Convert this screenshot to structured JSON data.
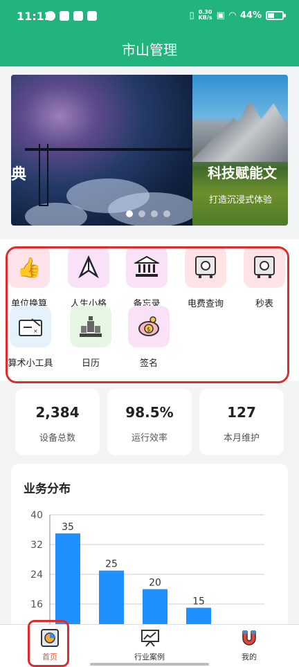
{
  "status_bar": {
    "time": "11:12",
    "speed_value": "0.30",
    "speed_unit": "KB/s",
    "battery": "44%",
    "battery_level": 0.44
  },
  "header": {
    "title": "市山管理"
  },
  "banner": {
    "slides": [
      {
        "caption": "典"
      },
      {
        "caption": "科技赋能文",
        "subcaption": "打造沉浸式体验"
      }
    ],
    "indicator_count": 4,
    "active_indicator": 0
  },
  "grid": {
    "items": [
      {
        "label": "单位换算",
        "icon": "thumbs-up-icon",
        "bg": "#ffe3ea"
      },
      {
        "label": "人生小格",
        "icon": "paper-plane-icon",
        "bg": "#f9e1f7"
      },
      {
        "label": "备忘录",
        "icon": "bank-icon",
        "bg": "#f9e1f7"
      },
      {
        "label": "电费查询",
        "icon": "safe-icon",
        "bg": "#ffe3e6"
      },
      {
        "label": "秒表",
        "icon": "safe-icon",
        "bg": "#ffe3e6"
      },
      {
        "label": "算术小工具",
        "icon": "calculator-board-icon",
        "bg": "#e3f2fc"
      },
      {
        "label": "日历",
        "icon": "chess-icon",
        "bg": "#e5f7e2"
      },
      {
        "label": "签名",
        "icon": "piggy-bank-icon",
        "bg": "#f9e1f7"
      }
    ]
  },
  "stats": [
    {
      "value": "2,384",
      "label": "设备总数"
    },
    {
      "value": "98.5%",
      "label": "运行效率"
    },
    {
      "value": "127",
      "label": "本月维护"
    }
  ],
  "chart_section": {
    "title": "业务分布"
  },
  "chart_data": {
    "type": "bar",
    "title": "业务分布",
    "categories": [
      "",
      "",
      "",
      ""
    ],
    "values": [
      35,
      25,
      20,
      15
    ],
    "yticks": [
      40,
      32,
      24,
      16
    ],
    "ylim": [
      8,
      40
    ],
    "grid": true,
    "bar_color": "#1e90ff"
  },
  "nav": {
    "items": [
      {
        "label": "首页",
        "icon": "dashboard-chart-icon",
        "active": true
      },
      {
        "label": "行业案例",
        "icon": "presentation-icon",
        "active": false
      },
      {
        "label": "我的",
        "icon": "magnet-icon",
        "active": false
      }
    ]
  },
  "colors": {
    "primary": "#21b47d",
    "accent": "#e05a2b",
    "highlight": "#e02b2b",
    "bar": "#1e90ff"
  }
}
